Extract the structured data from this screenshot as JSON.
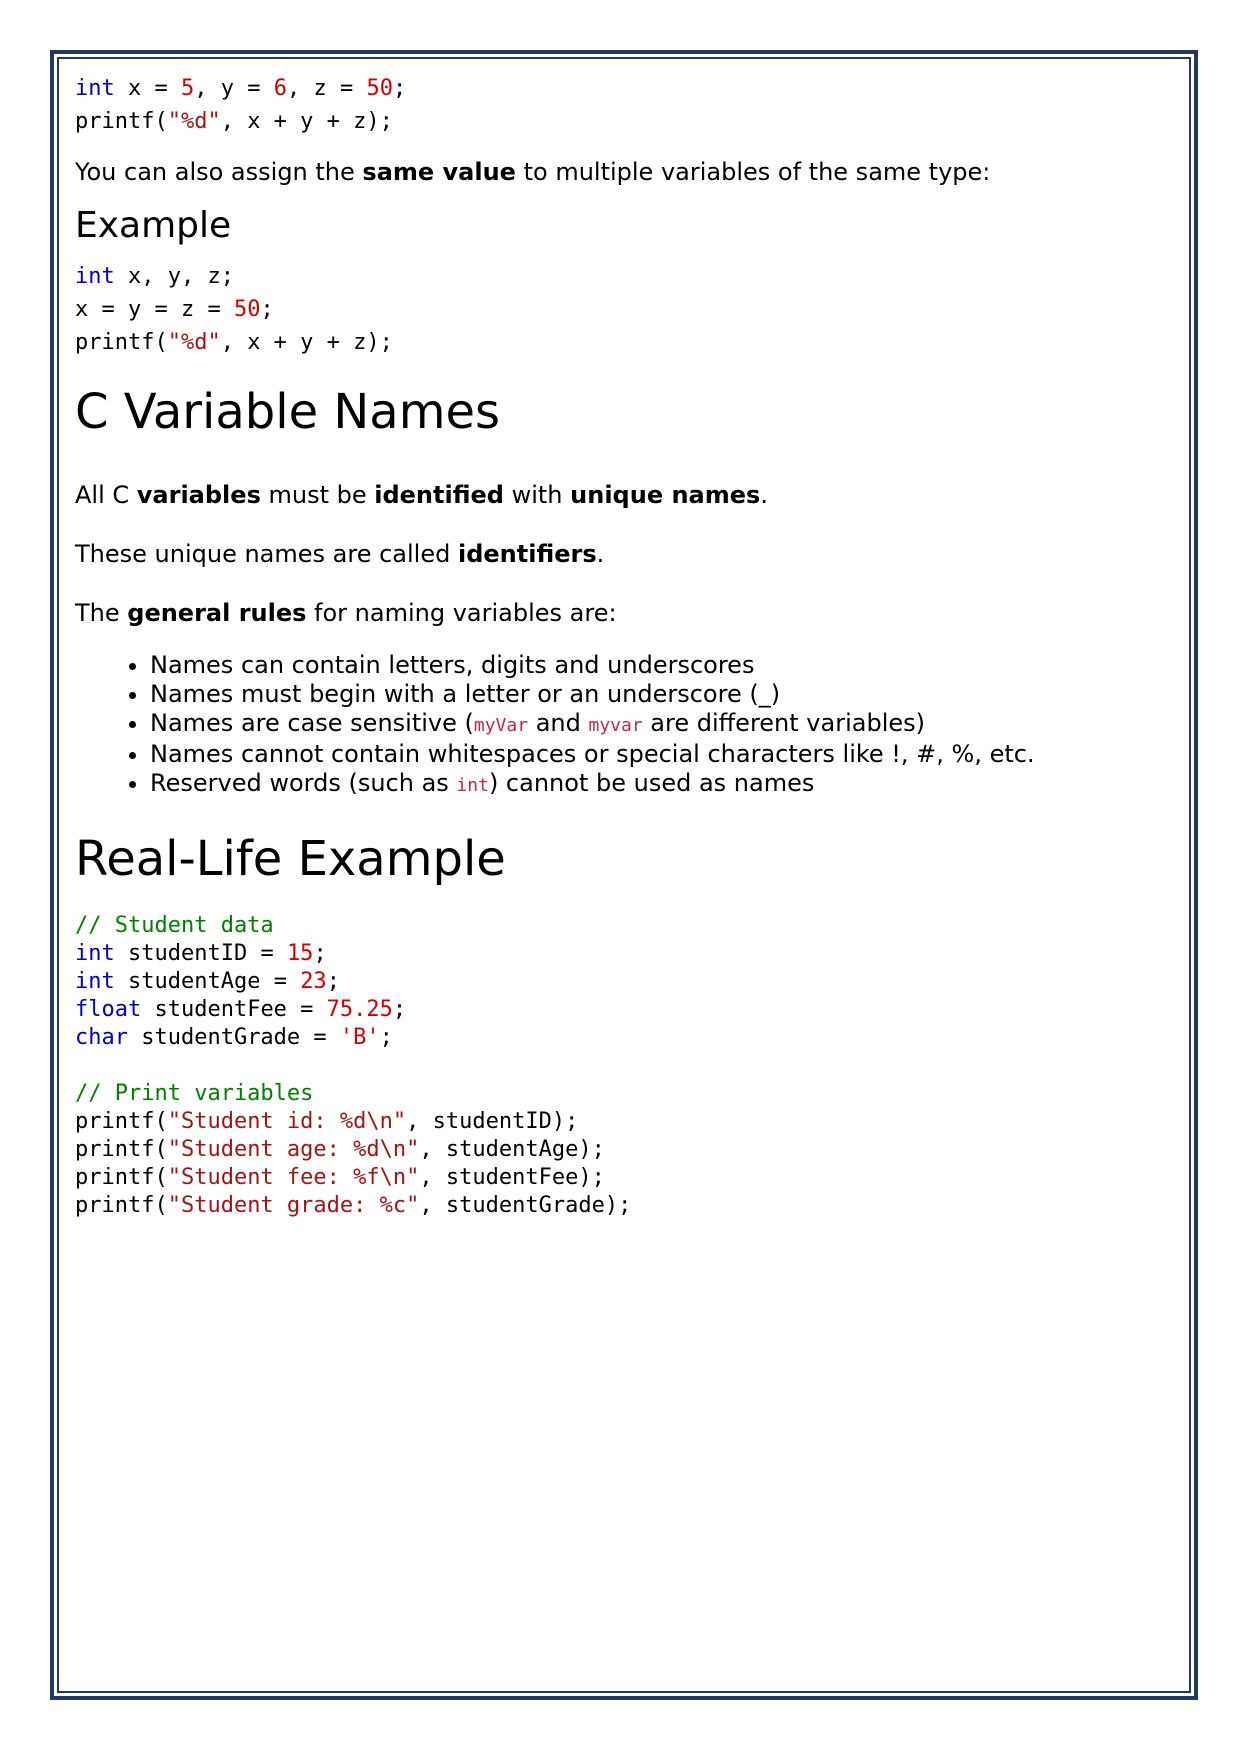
{
  "code1": {
    "line1": {
      "kw": "int",
      "a": " x = ",
      "n1": "5",
      "b": ", y = ",
      "n2": "6",
      "c": ", z = ",
      "n3": "50",
      "d": ";"
    },
    "line2": {
      "a": "printf(",
      "s": "\"%d\"",
      "b": ", x + y + z);"
    }
  },
  "para1": {
    "pre": "You can also assign the ",
    "bold": "same value",
    "post": " to multiple variables of the same type:"
  },
  "example_heading": "Example",
  "code2": {
    "line1": {
      "kw": "int",
      "a": " x, y, z;"
    },
    "line2": {
      "a": "x = y = z = ",
      "n": "50",
      "b": ";"
    },
    "line3": {
      "a": "printf(",
      "s": "\"%d\"",
      "b": ", x + y + z);"
    }
  },
  "section1_title": "C Variable Names",
  "para2": {
    "t1": "All C ",
    "b1": "variables",
    "t2": " must be ",
    "b2": "identified",
    "t3": " with ",
    "b3": "unique names",
    "t4": "."
  },
  "para3": {
    "t1": "These unique names are called ",
    "b1": "identifiers",
    "t2": "."
  },
  "para4": {
    "t1": "The ",
    "b1": "general rules",
    "t2": " for naming variables are:"
  },
  "rules": {
    "r1": "Names can contain letters, digits and underscores",
    "r2": "Names must begin with a letter or an underscore (_)",
    "r3": {
      "a": "Names are case sensitive (",
      "c1": "myVar",
      "b": " and ",
      "c2": "myvar",
      "c": " are different variables)"
    },
    "r4": "Names cannot contain whitespaces or special characters like !, #, %, etc.",
    "r5": {
      "a": "Reserved words (such as ",
      "c": "int",
      "b": ") cannot be used as names"
    }
  },
  "section2_title": "Real-Life Example",
  "code3": {
    "l1": "// Student data",
    "l2": {
      "kw": "int",
      "a": " studentID = ",
      "n": "15",
      "b": ";"
    },
    "l3": {
      "kw": "int",
      "a": " studentAge = ",
      "n": "23",
      "b": ";"
    },
    "l4": {
      "kw": "float",
      "a": " studentFee = ",
      "n": "75.25",
      "b": ";"
    },
    "l5": {
      "kw": "char",
      "a": " studentGrade = ",
      "n": "'B'",
      "b": ";"
    },
    "l7": "// Print variables",
    "l8": {
      "a": "printf(",
      "s": "\"Student id: %d\\n\"",
      "b": ", studentID);"
    },
    "l9": {
      "a": "printf(",
      "s": "\"Student age: %d\\n\"",
      "b": ", studentAge);"
    },
    "l10": {
      "a": "printf(",
      "s": "\"Student fee: %f\\n\"",
      "b": ", studentFee);"
    },
    "l11": {
      "a": "printf(",
      "s": "\"Student grade: %c\"",
      "b": ", studentGrade);"
    }
  },
  "colors": {
    "border": "#1f3864",
    "keyword": "#0000cd",
    "number": "#d40000",
    "string": "#a31515",
    "comment": "#008000",
    "inline_code": "#c7254e"
  }
}
